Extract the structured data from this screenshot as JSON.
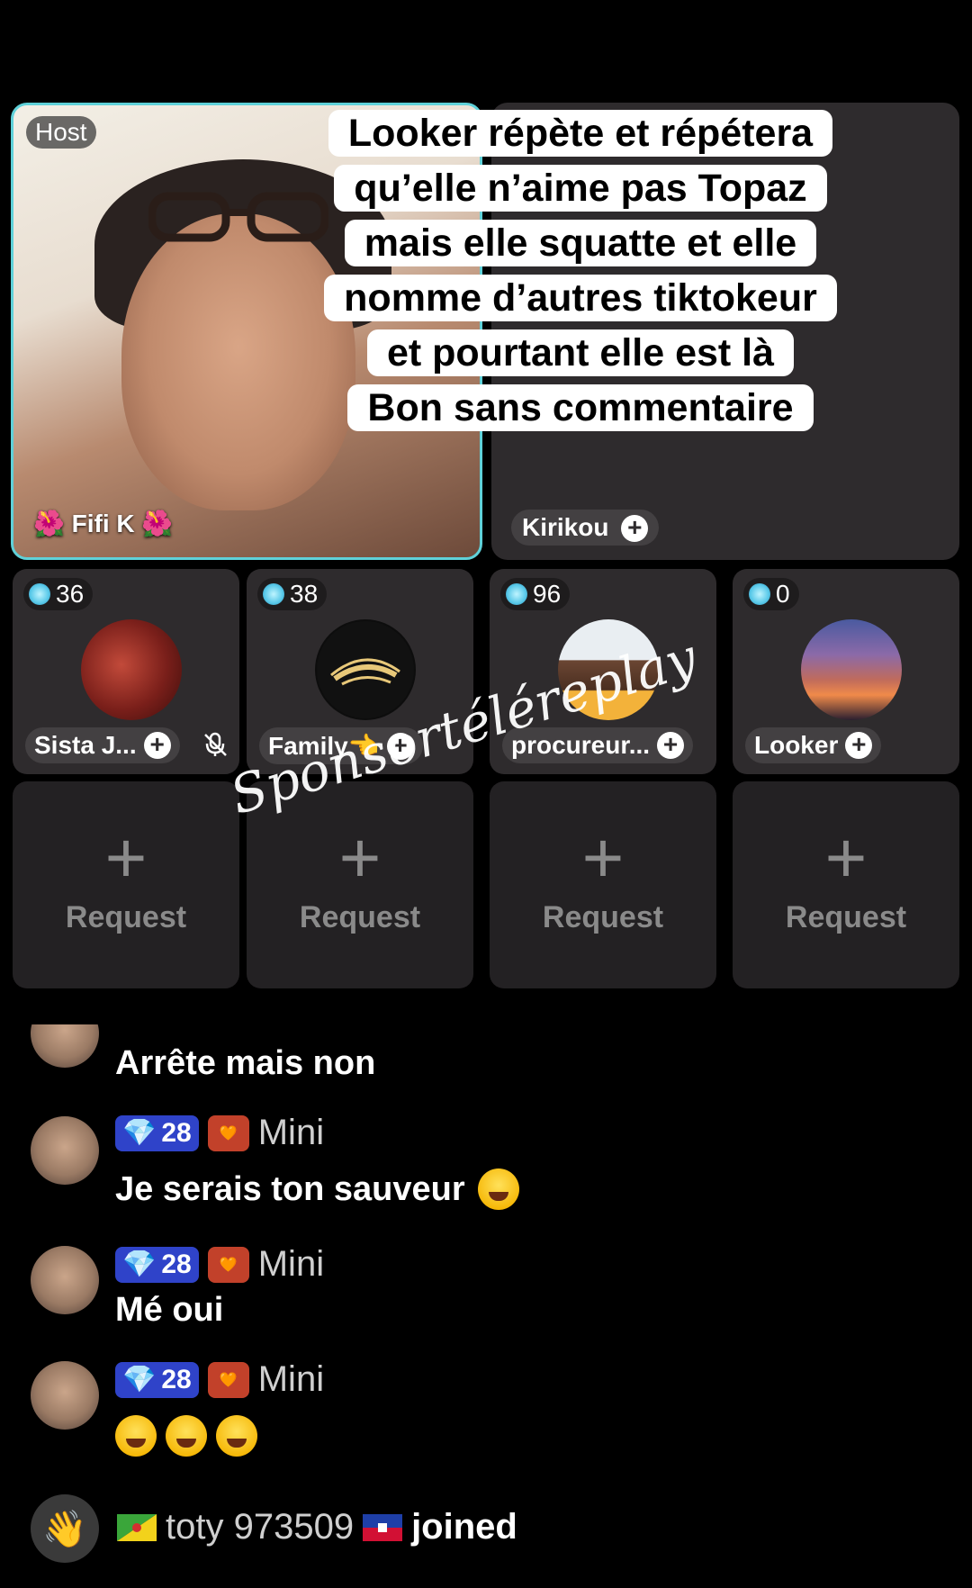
{
  "host": {
    "tag": "Host",
    "name": "🌺 Fifi K 🌺"
  },
  "guest_main": {
    "name": "Kirikou"
  },
  "caption": [
    "Looker répète et répétera",
    "qu’elle n’aime pas Topaz",
    "mais elle squatte et elle",
    "nomme d’autres tiktokeur",
    "et pourtant elle est là",
    "Bon sans commentaire"
  ],
  "guests": [
    {
      "score": "36",
      "name": "Sista J...",
      "muted": true
    },
    {
      "score": "38",
      "name": "Family👈"
    },
    {
      "score": "96",
      "name": "procureur..."
    },
    {
      "score": "0",
      "name": "Looker"
    }
  ],
  "requests": [
    "Request",
    "Request",
    "Request",
    "Request"
  ],
  "watermark": "Sponsortéléreplay",
  "chat": {
    "partial": {
      "msg": "Arrête mais non"
    },
    "messages": [
      {
        "level": "28",
        "user": "Mini",
        "msg": "Je serais ton sauveur",
        "emoji_count": 1
      },
      {
        "level": "28",
        "user": "Mini",
        "msg": "Mé oui",
        "emoji_count": 0
      },
      {
        "level": "28",
        "user": "Mini",
        "msg": "",
        "emoji_count": 3
      }
    ],
    "join": {
      "user": "toty 973509",
      "action": "joined"
    }
  },
  "icons": {
    "score": "gem-icon",
    "plus": "plus-icon",
    "mute": "mic-off-icon",
    "level": "diamond-icon",
    "fan": "heart-icon",
    "wave": "wave-hand-icon"
  }
}
